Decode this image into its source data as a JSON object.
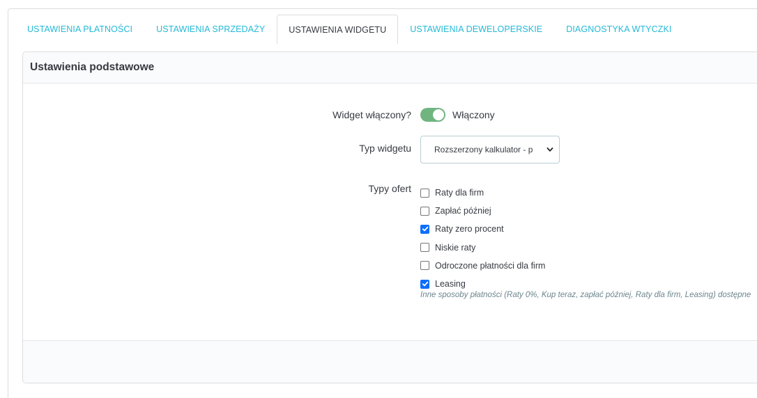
{
  "tabs": [
    {
      "label": "USTAWIENIA PŁATNOŚCI",
      "active": false
    },
    {
      "label": "USTAWIENIA SPRZEDAŻY",
      "active": false
    },
    {
      "label": "USTAWIENIA WIDGETU",
      "active": true
    },
    {
      "label": "USTAWIENIA DEWELOPERSKIE",
      "active": false
    },
    {
      "label": "DIAGNOSTYKA WTYCZKI",
      "active": false
    }
  ],
  "panel": {
    "title": "Ustawienia podstawowe"
  },
  "form": {
    "widget_enabled": {
      "label": "Widget włączony?",
      "state_text": "Włączony",
      "on": true
    },
    "widget_type": {
      "label": "Typ widgetu",
      "selected": "Rozszerzony kalkulator - p"
    },
    "offer_types": {
      "label": "Typy ofert",
      "options": [
        {
          "label": "Raty dla firm",
          "checked": false
        },
        {
          "label": "Zapłać później",
          "checked": false
        },
        {
          "label": "Raty zero procent",
          "checked": true
        },
        {
          "label": "Niskie raty",
          "checked": false
        },
        {
          "label": "Odroczone płatności dla firm",
          "checked": false
        },
        {
          "label": "Leasing",
          "checked": true
        }
      ],
      "help": "Inne sposoby płatności (Raty 0%, Kup teraz, zapłać później, Raty dla firm, Leasing) dostępne"
    }
  },
  "colors": {
    "accent": "#25b9d7",
    "toggle_on": "#70b580",
    "checkbox_checked": "#0d6efd"
  }
}
